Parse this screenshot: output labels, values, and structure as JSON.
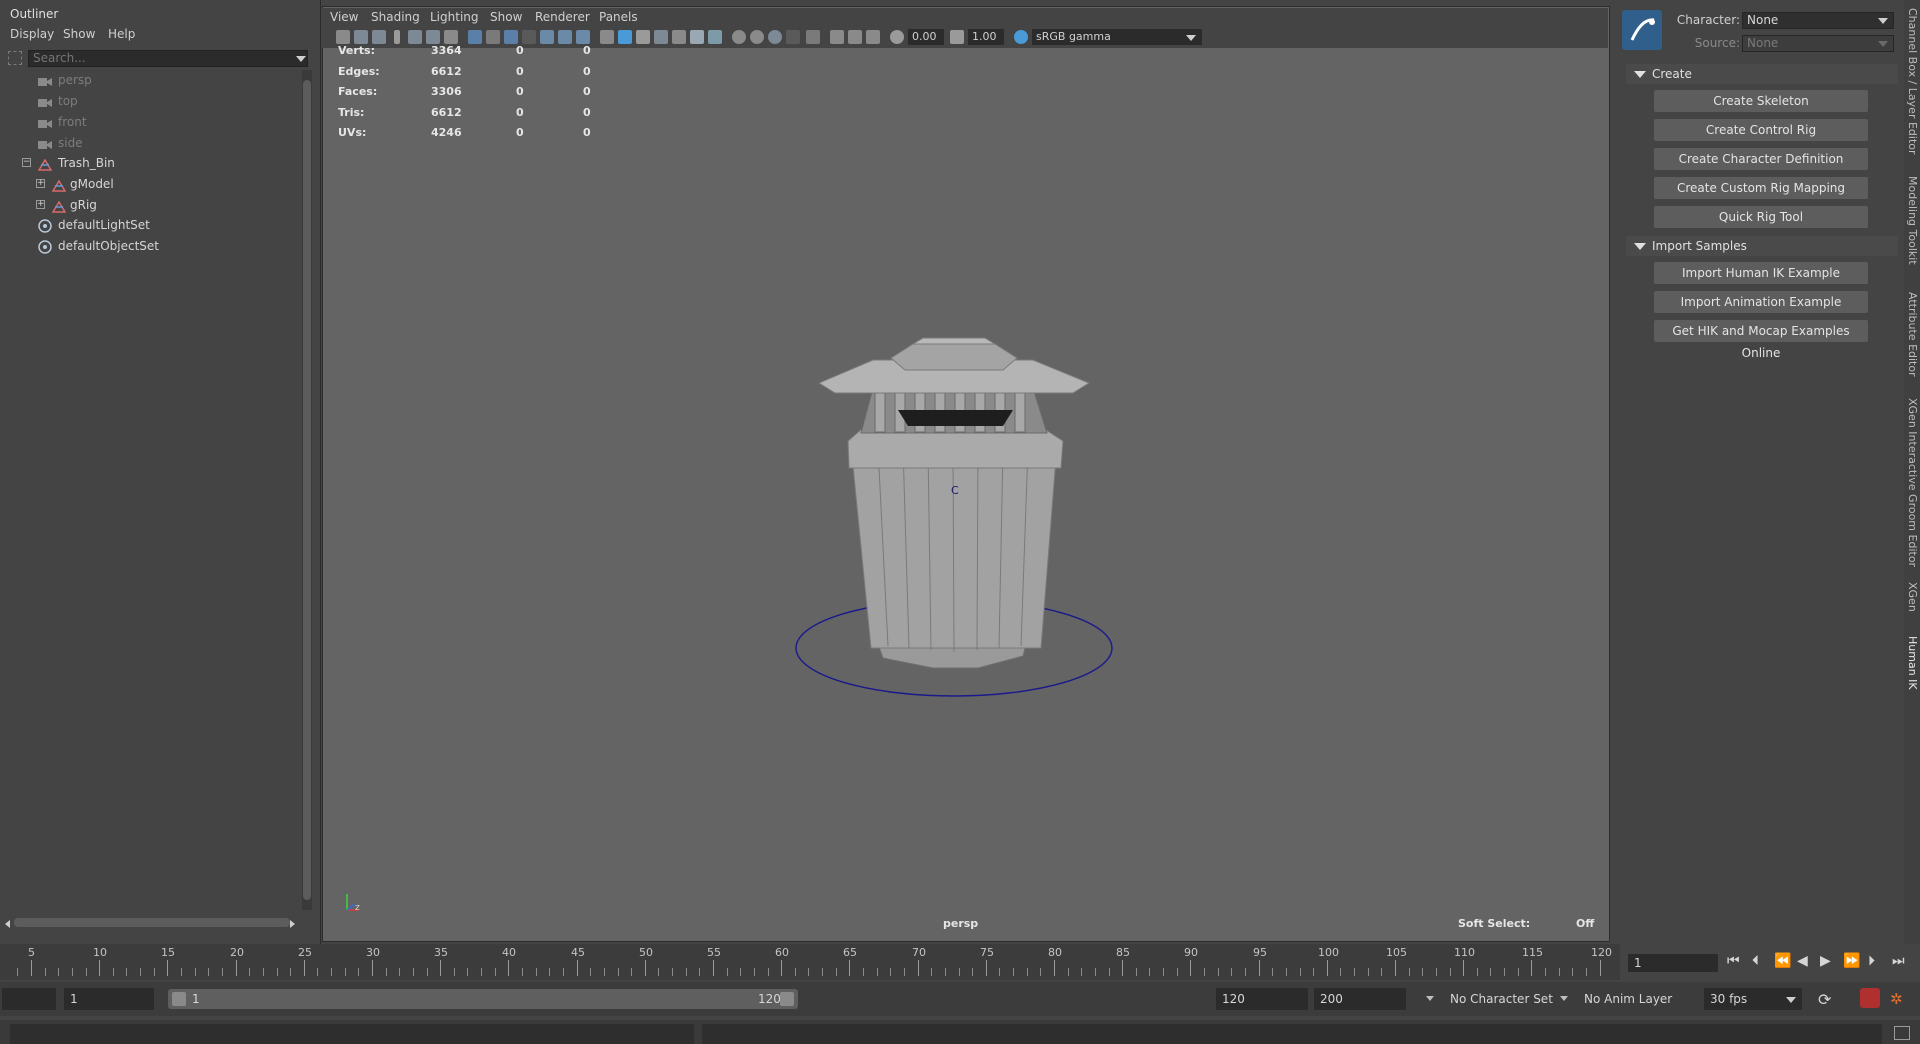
{
  "outliner": {
    "tab": "Outliner",
    "menu": [
      "Display",
      "Show",
      "Help"
    ],
    "search_placeholder": "Search...",
    "items": [
      {
        "label": "persp",
        "icon": "camera-icon"
      },
      {
        "label": "top",
        "icon": "camera-icon"
      },
      {
        "label": "front",
        "icon": "camera-icon"
      },
      {
        "label": "side",
        "icon": "camera-icon"
      },
      {
        "label": "Trash_Bin",
        "icon": "transform-group-icon"
      },
      {
        "label": "gModel",
        "icon": "transform-group-icon"
      },
      {
        "label": "gRig",
        "icon": "transform-group-icon"
      },
      {
        "label": "defaultLightSet",
        "icon": "set-icon"
      },
      {
        "label": "defaultObjectSet",
        "icon": "set-icon"
      }
    ]
  },
  "viewport": {
    "menu": [
      "View",
      "Shading",
      "Lighting",
      "Show",
      "Renderer",
      "Panels"
    ],
    "exposure": "0.00",
    "gamma": "1.00",
    "color_space": "sRGB gamma",
    "camera_label": "persp",
    "soft_select_label": "Soft Select:",
    "soft_select_value": "Off",
    "pivot_label": "C",
    "hud": [
      {
        "label": "Verts:",
        "v1": "3364",
        "v2": "0",
        "v3": "0"
      },
      {
        "label": "Edges:",
        "v1": "6612",
        "v2": "0",
        "v3": "0"
      },
      {
        "label": "Faces:",
        "v1": "3306",
        "v2": "0",
        "v3": "0"
      },
      {
        "label": "Tris:",
        "v1": "6612",
        "v2": "0",
        "v3": "0"
      },
      {
        "label": "UVs:",
        "v1": "4246",
        "v2": "0",
        "v3": "0"
      }
    ]
  },
  "human_ik": {
    "character_label": "Character:",
    "character_value": "None",
    "source_label": "Source:",
    "source_value": "None",
    "section_create": "Create",
    "create_buttons": [
      "Create Skeleton",
      "Create Control Rig",
      "Create Character Definition",
      "Create Custom Rig Mapping",
      "Quick Rig Tool"
    ],
    "section_import": "Import Samples",
    "import_buttons": [
      "Import Human IK Example",
      "Import Animation Example",
      "Get HIK and Mocap Examples Online"
    ]
  },
  "side_tabs": [
    "Channel Box / Layer Editor",
    "Modeling Toolkit",
    "Attribute Editor",
    "XGen Interactive Groom Editor",
    "XGen",
    "Human IK"
  ],
  "timeline": {
    "ticks": [
      "5",
      "10",
      "15",
      "20",
      "25",
      "30",
      "35",
      "40",
      "45",
      "50",
      "55",
      "60",
      "65",
      "70",
      "75",
      "80",
      "85",
      "90",
      "95",
      "100",
      "105",
      "110",
      "115",
      "120"
    ],
    "current_frame": "1",
    "range_start_outer": "1",
    "range_start_inner": "1",
    "range_end_inner": "120",
    "range_end_outer": "120",
    "anim_end": "200",
    "character_set": "No Character Set",
    "anim_layer": "No Anim Layer",
    "fps": "30 fps"
  }
}
